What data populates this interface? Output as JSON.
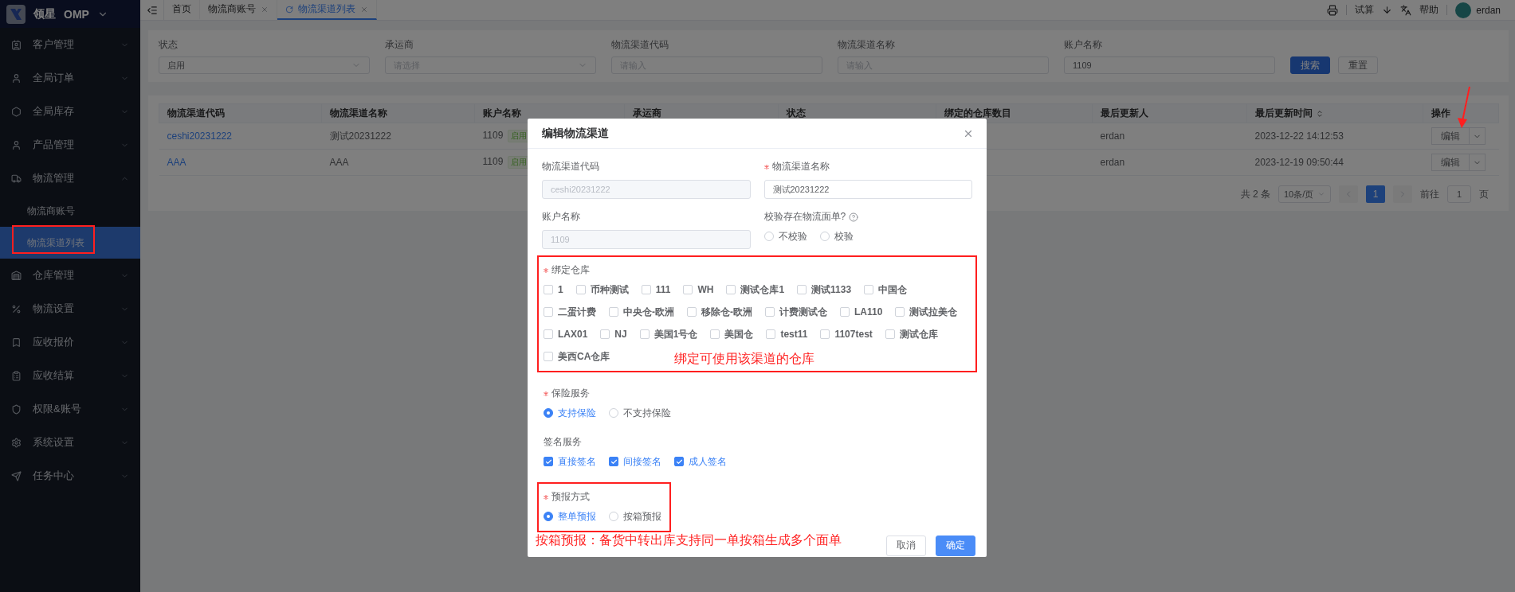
{
  "app": {
    "brand": "领星",
    "product": "OMP"
  },
  "sidebar": {
    "items": [
      {
        "label": "客户管理",
        "expanded": false
      },
      {
        "label": "全局订单",
        "expanded": false
      },
      {
        "label": "全局库存",
        "expanded": false
      },
      {
        "label": "产品管理",
        "expanded": false
      },
      {
        "label": "物流管理",
        "expanded": true,
        "children": [
          {
            "label": "物流商账号",
            "selected": false,
            "highlighted": false
          },
          {
            "label": "物流渠道列表",
            "selected": true,
            "highlighted": true
          }
        ]
      },
      {
        "label": "仓库管理",
        "expanded": false
      },
      {
        "label": "物流设置",
        "expanded": false
      },
      {
        "label": "应收报价",
        "expanded": false
      },
      {
        "label": "应收结算",
        "expanded": false
      },
      {
        "label": "权限&账号",
        "expanded": false
      },
      {
        "label": "系统设置",
        "expanded": false
      },
      {
        "label": "任务中心",
        "expanded": false
      }
    ]
  },
  "tabs": [
    {
      "label": "首页",
      "selected": false,
      "closable": false
    },
    {
      "label": "物流商账号",
      "selected": false,
      "closable": true
    },
    {
      "label": "物流渠道列表",
      "selected": true,
      "closable": true
    }
  ],
  "header_actions": {
    "trial": "试算",
    "help": "帮助",
    "user": "erdan"
  },
  "filters": [
    {
      "label": "状态",
      "kind": "select",
      "value": "启用"
    },
    {
      "label": "承运商",
      "kind": "select",
      "placeholder": "请选择"
    },
    {
      "label": "物流渠道代码",
      "kind": "input",
      "placeholder": "请输入"
    },
    {
      "label": "物流渠道名称",
      "kind": "input",
      "placeholder": "请输入"
    },
    {
      "label": "账户名称",
      "kind": "input",
      "value": "1109"
    }
  ],
  "filter_buttons": [
    {
      "label": "搜索",
      "kind": "primary"
    },
    {
      "label": "重置",
      "kind": "default"
    }
  ],
  "table": {
    "columns": [
      {
        "label": "物流渠道代码",
        "sortable": false
      },
      {
        "label": "物流渠道名称",
        "sortable": false
      },
      {
        "label": "账户名称",
        "sortable": false
      },
      {
        "label": "承运商",
        "sortable": false
      },
      {
        "label": "状态",
        "sortable": false
      },
      {
        "label": "绑定的仓库数目",
        "sortable": false
      },
      {
        "label": "最后更新人",
        "sortable": false
      },
      {
        "label": "最后更新时间",
        "sortable": true
      },
      {
        "label": "操作",
        "sortable": false
      }
    ],
    "rows": [
      {
        "code": "ceshi20231222",
        "name": "测试20231222",
        "account": "1109",
        "tag": "启用",
        "updated_by": "erdan",
        "updated_at": "2023-12-22 14:12:53",
        "action": "编辑"
      },
      {
        "code": "AAA",
        "name": "AAA",
        "account": "1109",
        "tag": "启用",
        "updated_by": "erdan",
        "updated_at": "2023-12-19 09:50:44",
        "action": "编辑"
      }
    ]
  },
  "pagination": {
    "total": "共 2 条",
    "page_size": "10条/页",
    "pages": [
      {
        "label": "1",
        "selected": true
      }
    ],
    "goto_label": "前往",
    "goto_value": "1",
    "goto_suffix": "页"
  },
  "dialog": {
    "title": "编辑物流渠道",
    "top_fields": [
      {
        "label": "物流渠道代码",
        "kind": "input",
        "required": false,
        "disabled": true,
        "value": "ceshi20231222"
      },
      {
        "label": "物流渠道名称",
        "kind": "input",
        "required": true,
        "disabled": false,
        "value": "测试20231222"
      },
      {
        "label": "账户名称",
        "kind": "input",
        "required": false,
        "disabled": true,
        "value": "1109"
      },
      {
        "label": "校验存在物流面单?",
        "kind": "radio",
        "required": false,
        "help": true,
        "options": [
          {
            "label": "不校验",
            "selected": false
          },
          {
            "label": "校验",
            "selected": false
          }
        ]
      }
    ],
    "sections": [
      {
        "label": "绑定仓库",
        "kind": "checkbox",
        "required": true,
        "highlighted": true,
        "note": "绑定可使用该渠道的仓库",
        "options": [
          {
            "label": "1",
            "checked": false
          },
          {
            "label": "币种测试",
            "checked": false
          },
          {
            "label": "111",
            "checked": false
          },
          {
            "label": "WH",
            "checked": false
          },
          {
            "label": "测试仓库1",
            "checked": false
          },
          {
            "label": "测试1133",
            "checked": false
          },
          {
            "label": "中国仓",
            "checked": false
          },
          {
            "label": "二蛋计费",
            "checked": false
          },
          {
            "label": "中央仓-欧洲",
            "checked": false
          },
          {
            "label": "移除仓-欧洲",
            "checked": false
          },
          {
            "label": "计费测试仓",
            "checked": false
          },
          {
            "label": "LA110",
            "checked": false
          },
          {
            "label": "测试拉美仓",
            "checked": false
          },
          {
            "label": "LAX01",
            "checked": false
          },
          {
            "label": "NJ",
            "checked": false
          },
          {
            "label": "美国1号仓",
            "checked": false
          },
          {
            "label": "美国仓",
            "checked": false
          },
          {
            "label": "test11",
            "checked": false
          },
          {
            "label": "1107test",
            "checked": false
          },
          {
            "label": "测试仓库",
            "checked": false
          },
          {
            "label": "美西CA仓库",
            "checked": false
          }
        ]
      },
      {
        "label": "保险服务",
        "kind": "radio",
        "required": true,
        "highlighted": false,
        "options": [
          {
            "label": "支持保险",
            "selected": true
          },
          {
            "label": "不支持保险",
            "selected": false
          }
        ]
      },
      {
        "label": "签名服务",
        "kind": "checkbox",
        "required": false,
        "highlighted": false,
        "options": [
          {
            "label": "直接签名",
            "checked": true
          },
          {
            "label": "间接签名",
            "checked": true
          },
          {
            "label": "成人签名",
            "checked": true
          }
        ]
      },
      {
        "label": "预报方式",
        "kind": "radio",
        "required": true,
        "highlighted": true,
        "options": [
          {
            "label": "整单预报",
            "selected": true
          },
          {
            "label": "按箱预报",
            "selected": false
          }
        ]
      }
    ],
    "footer_note": "按箱预报：备货中转出库支持同一单按箱生成多个面单",
    "buttons": [
      {
        "label": "取消",
        "kind": "default"
      },
      {
        "label": "确定",
        "kind": "primary"
      }
    ]
  }
}
